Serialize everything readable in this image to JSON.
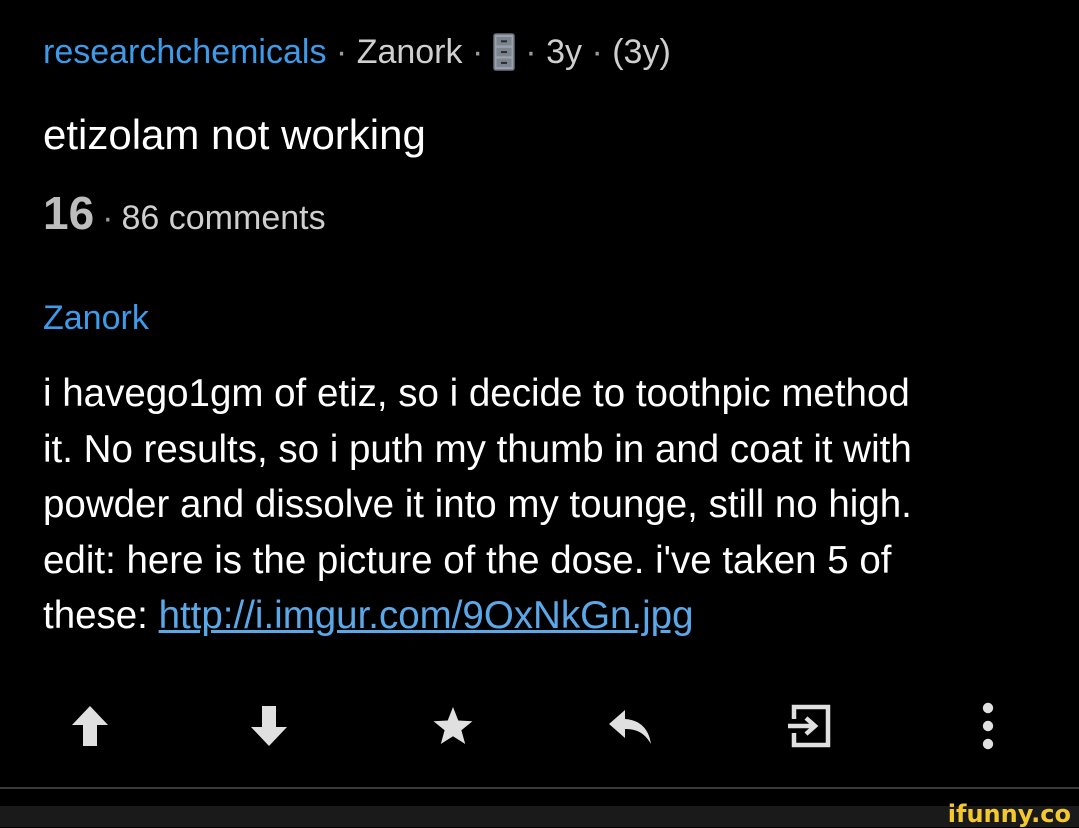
{
  "post": {
    "subreddit": "researchchemicals",
    "separator": "·",
    "author": "Zanork",
    "age": "3y",
    "edited_age": "(3y)",
    "title": "etizolam not working",
    "score": "16",
    "comments": "86 comments"
  },
  "comment": {
    "author": "Zanork",
    "lines": [
      "i havego1gm of etiz, so i decide to toothpic method",
      "it. No results, so i puth my thumb in and coat it with",
      "powder and dissolve it into my tounge, still no high.",
      "edit: here is the picture of the dose. i've taken 5 of"
    ],
    "last_line_prefix": "these: ",
    "link_text": "http://i.imgur.com/9OxNkGn.jpg"
  },
  "actions": {
    "icons": [
      "upvote-icon",
      "downvote-icon",
      "star-icon",
      "reply-icon",
      "open-icon",
      "more-icon"
    ]
  },
  "watermark": "ifunny.co",
  "colors": {
    "background": "#000000",
    "link_blue": "#3d9be9",
    "text": "#ffffff",
    "muted": "#cfcfcf",
    "icon": "#e0e0e0",
    "watermark": "#f3c92e"
  }
}
